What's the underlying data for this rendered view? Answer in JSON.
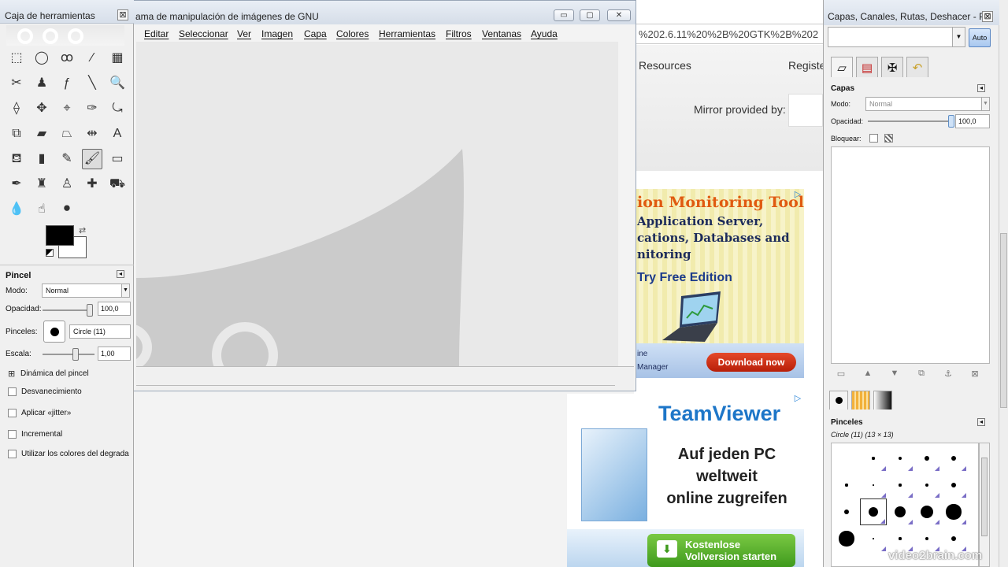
{
  "toolbox": {
    "title": "Caja de herramientas",
    "close_glyph": "⊠",
    "tools": [
      {
        "name": "rect-select-icon",
        "glyph": "⬚"
      },
      {
        "name": "ellipse-select-icon",
        "glyph": "◯"
      },
      {
        "name": "free-select-icon",
        "glyph": "ꝏ"
      },
      {
        "name": "fuzzy-select-icon",
        "glyph": "⁄"
      },
      {
        "name": "select-by-color-icon",
        "glyph": "▦"
      },
      {
        "name": "scissors-select-icon",
        "glyph": "✂"
      },
      {
        "name": "foreground-select-icon",
        "glyph": "♟"
      },
      {
        "name": "paths-icon",
        "glyph": "ƒ"
      },
      {
        "name": "color-picker-icon",
        "glyph": "╲"
      },
      {
        "name": "zoom-icon",
        "glyph": "🔍"
      },
      {
        "name": "measure-icon",
        "glyph": "⟠"
      },
      {
        "name": "move-icon",
        "glyph": "✥"
      },
      {
        "name": "align-icon",
        "glyph": "⌖"
      },
      {
        "name": "crop-icon",
        "glyph": "✑"
      },
      {
        "name": "rotate-icon",
        "glyph": "⤿"
      },
      {
        "name": "scale-icon",
        "glyph": "⧉"
      },
      {
        "name": "shear-icon",
        "glyph": "▰"
      },
      {
        "name": "perspective-icon",
        "glyph": "⏢"
      },
      {
        "name": "flip-icon",
        "glyph": "⇹"
      },
      {
        "name": "text-icon",
        "glyph": "A"
      },
      {
        "name": "bucket-fill-icon",
        "glyph": "⛾"
      },
      {
        "name": "blend-icon",
        "glyph": "▮"
      },
      {
        "name": "pencil-icon",
        "glyph": "✎"
      },
      {
        "name": "paintbrush-icon",
        "glyph": "🖌"
      },
      {
        "name": "eraser-icon",
        "glyph": "▭"
      },
      {
        "name": "airbrush-icon",
        "glyph": "✒"
      },
      {
        "name": "ink-icon",
        "glyph": "♜"
      },
      {
        "name": "clone-icon",
        "glyph": "♙"
      },
      {
        "name": "heal-icon",
        "glyph": "✚"
      },
      {
        "name": "perspective-clone-icon",
        "glyph": "⛟"
      },
      {
        "name": "blur-icon",
        "glyph": "💧"
      },
      {
        "name": "smudge-icon",
        "glyph": "☝"
      },
      {
        "name": "dodge-burn-icon",
        "glyph": "⚫"
      }
    ],
    "options": {
      "header": "Pincel",
      "mode_label": "Modo:",
      "mode_value": "Normal",
      "opacity_label": "Opacidad:",
      "opacity_value": "100,0",
      "opacity_level": 1.0,
      "brushes_label": "Pinceles:",
      "brush_value": "Circle (11)",
      "scale_label": "Escala:",
      "scale_value": "1,00",
      "dynamics_label": "Dinámica del pincel",
      "checks": [
        "Desvanecimiento",
        "Aplicar «jitter»",
        "Incremental",
        "Utilizar los colores del degradado"
      ]
    }
  },
  "image_window": {
    "title": "ama de manipulación de imágenes de GNU",
    "menu": [
      "Editar",
      "Seleccionar",
      "Ver",
      "Imagen",
      "Capa",
      "Colores",
      "Herramientas",
      "Filtros",
      "Ventanas",
      "Ayuda"
    ],
    "buttons": {
      "minimize": "▭",
      "maximize": "▢",
      "close": "✕"
    }
  },
  "browser": {
    "url_fragment": "%202.6.11%20%2B%20GTK%2B%202",
    "nav": [
      "Resources",
      "Registe"
    ],
    "mirror_label": "Mirror provided by:",
    "ad1": {
      "title": "ion Monitoring Tool",
      "lines": [
        "Application Server,",
        "cations, Databases and",
        "nitoring"
      ],
      "cta": "Try Free Edition",
      "small": [
        "ine",
        "Manager"
      ],
      "download": "Download now"
    },
    "ad2": {
      "brand": "TeamViewer",
      "lines": [
        "Auf jeden PC",
        "weltweit",
        "online zugreifen"
      ],
      "button_lines": [
        "Kostenlose",
        "Vollversion starten"
      ]
    }
  },
  "dock": {
    "title": "Capas, Canales, Rutas, Deshacer - P...",
    "auto_label": "Auto",
    "layers": {
      "header": "Capas",
      "mode_label": "Modo:",
      "mode_value": "Normal",
      "opacity_label": "Opacidad:",
      "opacity_value": "100,0",
      "lock_label": "Bloquear:"
    },
    "brushes": {
      "header": "Pinceles",
      "selected": "Circle (11) (13 × 13)"
    }
  },
  "watermark": "video2brain.com"
}
